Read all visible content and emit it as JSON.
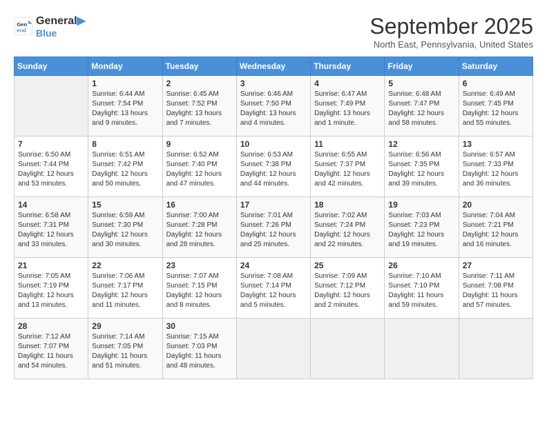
{
  "logo": {
    "line1": "General",
    "line2": "Blue"
  },
  "title": "September 2025",
  "location": "North East, Pennsylvania, United States",
  "weekdays": [
    "Sunday",
    "Monday",
    "Tuesday",
    "Wednesday",
    "Thursday",
    "Friday",
    "Saturday"
  ],
  "weeks": [
    [
      {
        "day": "",
        "info": ""
      },
      {
        "day": "1",
        "info": "Sunrise: 6:44 AM\nSunset: 7:54 PM\nDaylight: 13 hours\nand 9 minutes."
      },
      {
        "day": "2",
        "info": "Sunrise: 6:45 AM\nSunset: 7:52 PM\nDaylight: 13 hours\nand 7 minutes."
      },
      {
        "day": "3",
        "info": "Sunrise: 6:46 AM\nSunset: 7:50 PM\nDaylight: 13 hours\nand 4 minutes."
      },
      {
        "day": "4",
        "info": "Sunrise: 6:47 AM\nSunset: 7:49 PM\nDaylight: 13 hours\nand 1 minute."
      },
      {
        "day": "5",
        "info": "Sunrise: 6:48 AM\nSunset: 7:47 PM\nDaylight: 12 hours\nand 58 minutes."
      },
      {
        "day": "6",
        "info": "Sunrise: 6:49 AM\nSunset: 7:45 PM\nDaylight: 12 hours\nand 55 minutes."
      }
    ],
    [
      {
        "day": "7",
        "info": "Sunrise: 6:50 AM\nSunset: 7:44 PM\nDaylight: 12 hours\nand 53 minutes."
      },
      {
        "day": "8",
        "info": "Sunrise: 6:51 AM\nSunset: 7:42 PM\nDaylight: 12 hours\nand 50 minutes."
      },
      {
        "day": "9",
        "info": "Sunrise: 6:52 AM\nSunset: 7:40 PM\nDaylight: 12 hours\nand 47 minutes."
      },
      {
        "day": "10",
        "info": "Sunrise: 6:53 AM\nSunset: 7:38 PM\nDaylight: 12 hours\nand 44 minutes."
      },
      {
        "day": "11",
        "info": "Sunrise: 6:55 AM\nSunset: 7:37 PM\nDaylight: 12 hours\nand 42 minutes."
      },
      {
        "day": "12",
        "info": "Sunrise: 6:56 AM\nSunset: 7:35 PM\nDaylight: 12 hours\nand 39 minutes."
      },
      {
        "day": "13",
        "info": "Sunrise: 6:57 AM\nSunset: 7:33 PM\nDaylight: 12 hours\nand 36 minutes."
      }
    ],
    [
      {
        "day": "14",
        "info": "Sunrise: 6:58 AM\nSunset: 7:31 PM\nDaylight: 12 hours\nand 33 minutes."
      },
      {
        "day": "15",
        "info": "Sunrise: 6:59 AM\nSunset: 7:30 PM\nDaylight: 12 hours\nand 30 minutes."
      },
      {
        "day": "16",
        "info": "Sunrise: 7:00 AM\nSunset: 7:28 PM\nDaylight: 12 hours\nand 28 minutes."
      },
      {
        "day": "17",
        "info": "Sunrise: 7:01 AM\nSunset: 7:26 PM\nDaylight: 12 hours\nand 25 minutes."
      },
      {
        "day": "18",
        "info": "Sunrise: 7:02 AM\nSunset: 7:24 PM\nDaylight: 12 hours\nand 22 minutes."
      },
      {
        "day": "19",
        "info": "Sunrise: 7:03 AM\nSunset: 7:23 PM\nDaylight: 12 hours\nand 19 minutes."
      },
      {
        "day": "20",
        "info": "Sunrise: 7:04 AM\nSunset: 7:21 PM\nDaylight: 12 hours\nand 16 minutes."
      }
    ],
    [
      {
        "day": "21",
        "info": "Sunrise: 7:05 AM\nSunset: 7:19 PM\nDaylight: 12 hours\nand 13 minutes."
      },
      {
        "day": "22",
        "info": "Sunrise: 7:06 AM\nSunset: 7:17 PM\nDaylight: 12 hours\nand 11 minutes."
      },
      {
        "day": "23",
        "info": "Sunrise: 7:07 AM\nSunset: 7:15 PM\nDaylight: 12 hours\nand 8 minutes."
      },
      {
        "day": "24",
        "info": "Sunrise: 7:08 AM\nSunset: 7:14 PM\nDaylight: 12 hours\nand 5 minutes."
      },
      {
        "day": "25",
        "info": "Sunrise: 7:09 AM\nSunset: 7:12 PM\nDaylight: 12 hours\nand 2 minutes."
      },
      {
        "day": "26",
        "info": "Sunrise: 7:10 AM\nSunset: 7:10 PM\nDaylight: 11 hours\nand 59 minutes."
      },
      {
        "day": "27",
        "info": "Sunrise: 7:11 AM\nSunset: 7:08 PM\nDaylight: 11 hours\nand 57 minutes."
      }
    ],
    [
      {
        "day": "28",
        "info": "Sunrise: 7:12 AM\nSunset: 7:07 PM\nDaylight: 11 hours\nand 54 minutes."
      },
      {
        "day": "29",
        "info": "Sunrise: 7:14 AM\nSunset: 7:05 PM\nDaylight: 11 hours\nand 51 minutes."
      },
      {
        "day": "30",
        "info": "Sunrise: 7:15 AM\nSunset: 7:03 PM\nDaylight: 11 hours\nand 48 minutes."
      },
      {
        "day": "",
        "info": ""
      },
      {
        "day": "",
        "info": ""
      },
      {
        "day": "",
        "info": ""
      },
      {
        "day": "",
        "info": ""
      }
    ]
  ]
}
